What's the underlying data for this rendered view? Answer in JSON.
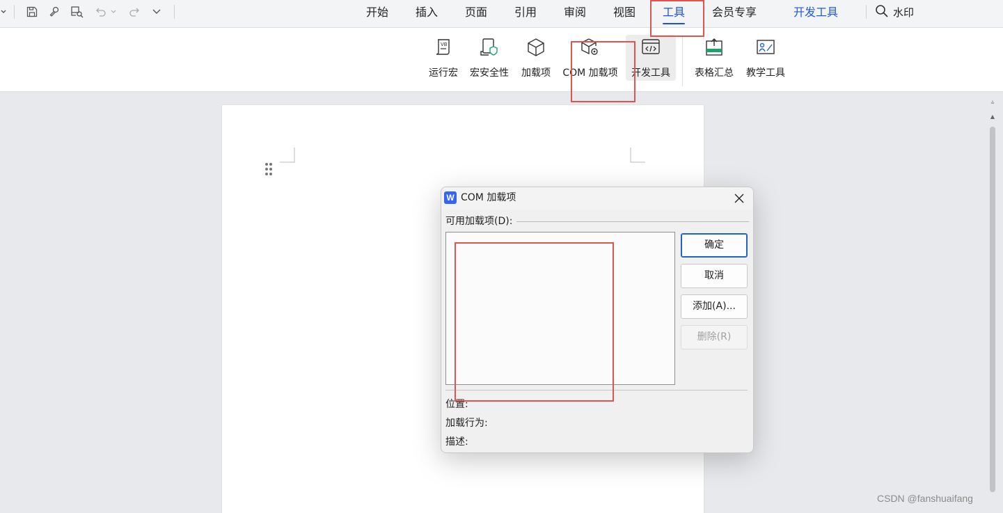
{
  "menu_tabs": {
    "start": "开始",
    "insert": "插入",
    "page": "页面",
    "reference": "引用",
    "review": "审阅",
    "view": "视图",
    "tools": "工具",
    "member": "会员专享",
    "developer": "开发工具",
    "search": "水印"
  },
  "ribbon": {
    "run_macro": "运行宏",
    "macro_security": "宏安全性",
    "addins": "加载项",
    "com_addins": "COM 加载项",
    "dev_tools": "开发工具",
    "table_summary": "表格汇总",
    "teaching_tools": "教学工具",
    "macro_icon_text": "VB"
  },
  "dialog": {
    "logo": "W",
    "title": "COM 加载项",
    "available_label": "可用加载项(D):",
    "ok": "确定",
    "cancel": "取消",
    "add": "添加(A)...",
    "remove": "删除(R)",
    "location_label": "位置:",
    "load_behavior_label": "加载行为:",
    "description_label": "描述:"
  },
  "watermark": "CSDN @fanshuaifang",
  "colors": {
    "accent": "#1f4fe0",
    "annotation": "#e0534f",
    "primary_button_border": "#1f62c8"
  }
}
